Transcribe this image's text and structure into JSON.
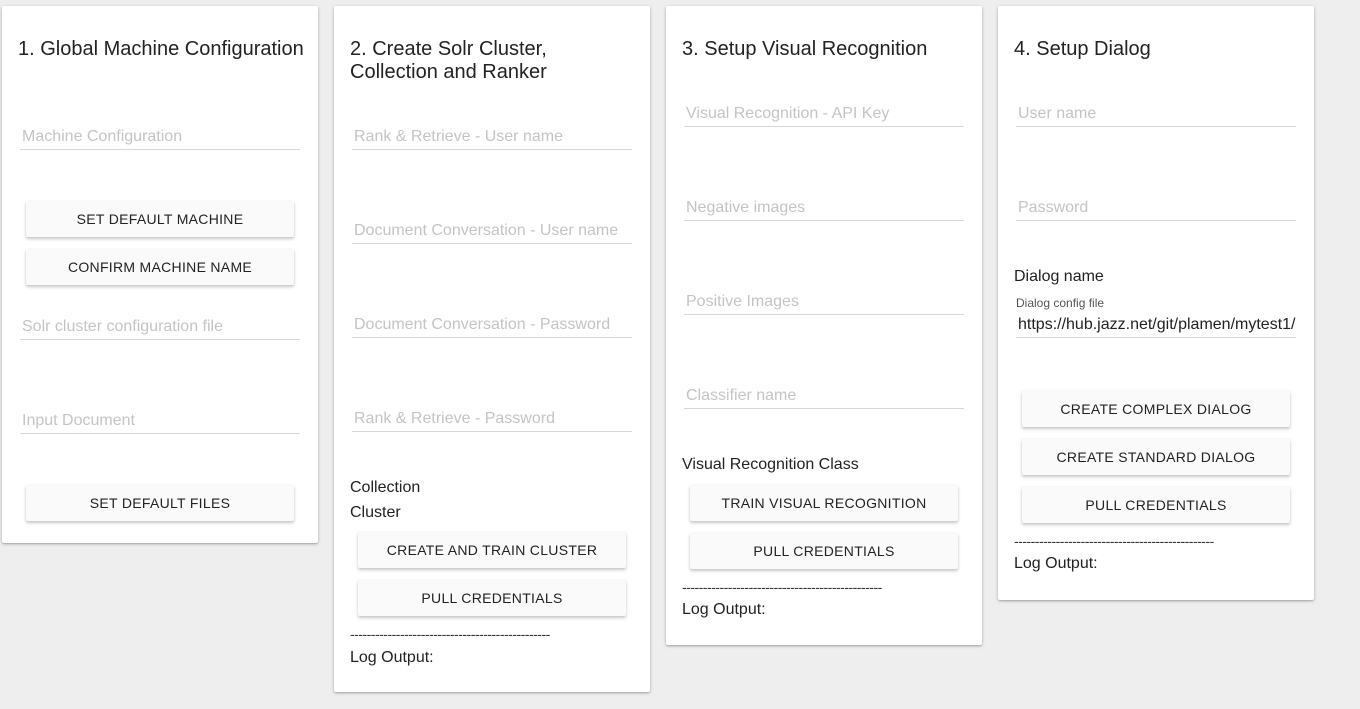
{
  "card1": {
    "title": "1. Global Machine Configuration",
    "machine_config_placeholder": "Machine Configuration",
    "set_default_machine": "SET DEFAULT MACHINE",
    "confirm_machine_name": "CONFIRM MACHINE NAME",
    "solr_config_placeholder": "Solr cluster configuration file",
    "input_document_placeholder": "Input Document",
    "set_default_files": "SET DEFAULT FILES"
  },
  "card2": {
    "title": "2. Create Solr Cluster, Collection and Ranker",
    "rr_user_placeholder": "Rank & Retrieve - User name",
    "dc_user_placeholder": "Document Conversation - User name",
    "dc_password_placeholder": "Document Conversation - Password",
    "rr_password_placeholder": "Rank & Retrieve - Password",
    "collection_label": "Collection",
    "cluster_label": "Cluster",
    "create_train_cluster": "CREATE AND TRAIN CLUSTER",
    "pull_credentials": "PULL CREDENTIALS",
    "separator": "------------------------------------------------",
    "log_output": "Log Output:"
  },
  "card3": {
    "title": "3. Setup Visual Recognition",
    "api_key_placeholder": "Visual Recognition - API Key",
    "negative_images_placeholder": "Negative images",
    "positive_images_placeholder": "Positive Images",
    "classifier_name_placeholder": "Classifier name",
    "vr_class_label": "Visual Recognition Class",
    "train_vr": "TRAIN VISUAL RECOGNITION",
    "pull_credentials": "PULL CREDENTIALS",
    "separator": "------------------------------------------------",
    "log_output": "Log Output:"
  },
  "card4": {
    "title": "4. Setup Dialog",
    "username_placeholder": "User name",
    "password_placeholder": "Password",
    "dialog_name_label": "Dialog name",
    "dialog_config_label": "Dialog config file",
    "dialog_config_value": "https://hub.jazz.net/git/plamen/mytest1/",
    "create_complex_dialog": "CREATE COMPLEX DIALOG",
    "create_standard_dialog": "CREATE STANDARD DIALOG",
    "pull_credentials": "PULL CREDENTIALS",
    "separator": "------------------------------------------------",
    "log_output": "Log Output:"
  }
}
